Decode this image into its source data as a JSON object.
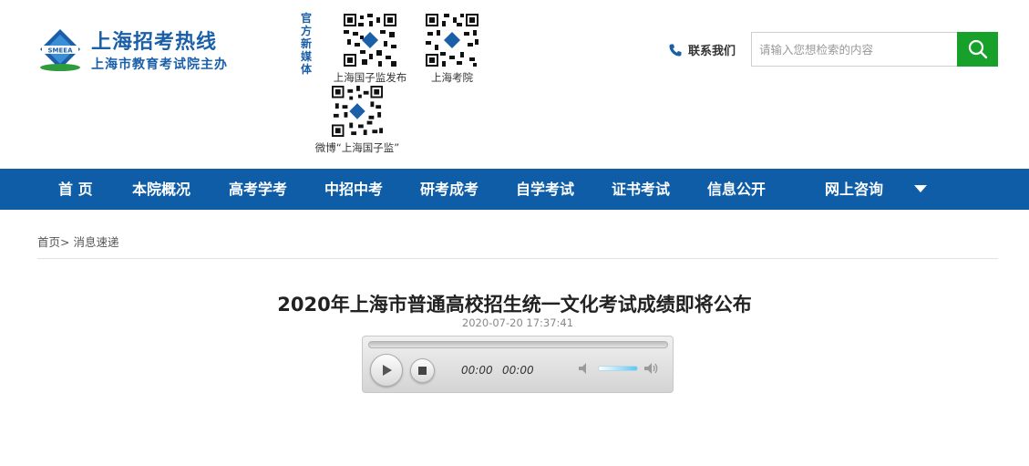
{
  "header": {
    "logo": {
      "title": "上海招考热线",
      "subtitle": "上海市教育考试院主办",
      "emblem_text": "SMEEA"
    },
    "media_label": "官方新媒体",
    "qr_codes": [
      {
        "caption": "上海国子监发布"
      },
      {
        "caption": "上海考院"
      },
      {
        "caption": "微博“上海国子监”"
      }
    ],
    "contact_label": "联系我们",
    "search": {
      "placeholder": "请输入您想检索的内容",
      "button_icon": "search-icon"
    }
  },
  "nav": {
    "items": [
      "首 页",
      "本院概况",
      "高考学考",
      "中招中考",
      "研考成考",
      "自学考试",
      "证书考试",
      "信息公开",
      "网上咨询"
    ]
  },
  "breadcrumb": {
    "home": "首页",
    "separator": ">",
    "current": "消息速递"
  },
  "article": {
    "title": "2020年上海市普通高校招生统一文化考试成绩即将公布",
    "date": "2020-07-20 17:37:41"
  },
  "player": {
    "current_time": "00:00",
    "duration": "00:00"
  },
  "colors": {
    "brand_blue": "#0f5da6",
    "search_green": "#17a02a"
  }
}
